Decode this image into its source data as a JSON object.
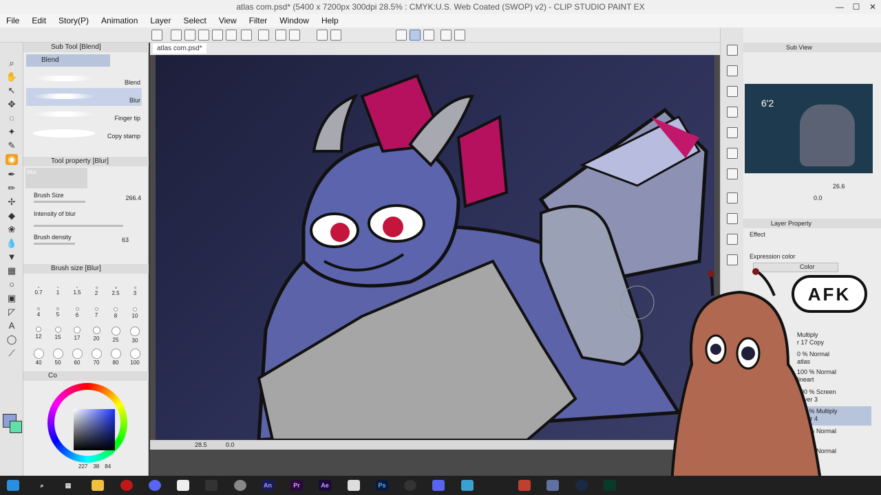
{
  "window": {
    "title": "atlas com.psd* (5400 x 7200px 300dpi 28.5% : CMYK:U.S. Web Coated (SWOP) v2) - CLIP STUDIO PAINT EX",
    "controls": [
      "—",
      "☐",
      "✕"
    ]
  },
  "menu": [
    "File",
    "Edit",
    "Story(P)",
    "Animation",
    "Layer",
    "Select",
    "View",
    "Filter",
    "Window",
    "Help"
  ],
  "sub_tool": {
    "header": "Sub Tool [Blend]",
    "group": "Blend",
    "items": [
      {
        "label": "Blend",
        "selected": false
      },
      {
        "label": "Blur",
        "selected": true
      },
      {
        "label": "Finger tip",
        "selected": false
      },
      {
        "label": "Copy stamp",
        "selected": false
      }
    ]
  },
  "tool_property": {
    "header": "Tool property [Blur]",
    "preview_label": "Blur",
    "brush_size_label": "Brush Size",
    "brush_size_value": "266.4",
    "intensity_label": "Intensity of blur",
    "density_label": "Brush density",
    "density_value": "63"
  },
  "brush_size_panel": {
    "header": "Brush size [Blur]",
    "sizes": [
      "0.7",
      "1",
      "1.5",
      "2",
      "2.5",
      "3",
      "4",
      "5",
      "6",
      "7",
      "8",
      "10",
      "12",
      "15",
      "17",
      "20",
      "25",
      "30",
      "40",
      "50",
      "60",
      "70",
      "80",
      "100"
    ]
  },
  "color_panel": {
    "readout": [
      "227",
      "38",
      "84"
    ],
    "tab": "Co"
  },
  "document": {
    "tab": "atlas com.psd*",
    "zoom": "28.5",
    "rotation": "0.0"
  },
  "sub_view": {
    "header": "Sub View",
    "zoom": "26.6",
    "rotation": "0.0",
    "thumb_text": "6'2"
  },
  "layer_property": {
    "header": "Layer Property",
    "effect_label": "Effect",
    "expression_label": "Expression color",
    "expression_value": "Color"
  },
  "layers": [
    {
      "mode": "Multiply",
      "name": "r 17 Copy"
    },
    {
      "mode": "0 % Normal",
      "name": "atlas"
    },
    {
      "mode": "100 % Normal",
      "name": "lineart"
    },
    {
      "mode": "100 % Screen",
      "name": "Layer 3"
    },
    {
      "mode": "100 % Multiply",
      "name": "Layer 4",
      "selected": true
    },
    {
      "mode": "100 % Normal",
      "name": "n"
    },
    {
      "mode": "100 % Normal",
      "name": ""
    }
  ],
  "overlay": {
    "afk": "AFK"
  },
  "taskbar_labels": [
    "Ae",
    "An",
    "Pr",
    "Ps"
  ],
  "colors": {
    "accent": "#f0a020",
    "selection": "#b8c4dc",
    "canvas_bg": "#2b2e55"
  }
}
